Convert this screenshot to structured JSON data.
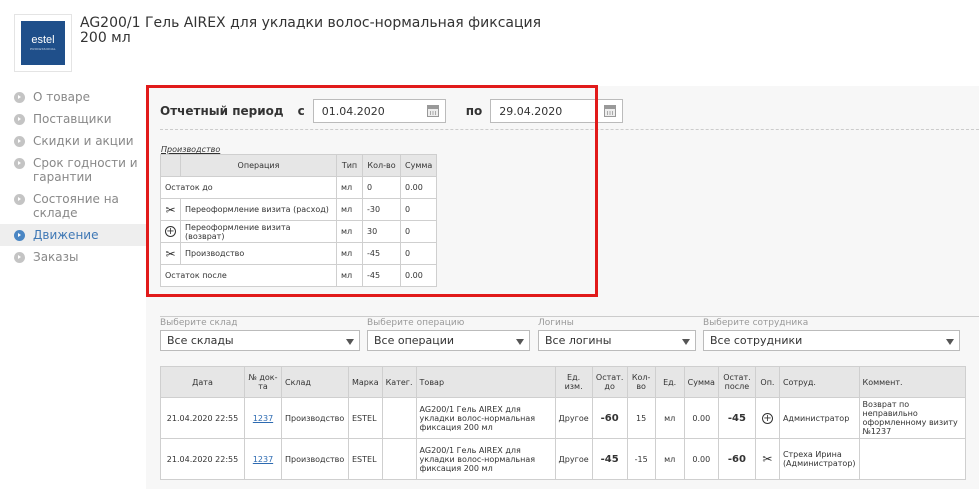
{
  "header": {
    "logo_text": "estel",
    "logo_subtext": "PROFESSIONAL",
    "title_line1": "AG200/1 Гель AIREX для укладки волос-нормальная фиксация",
    "title_line2": "200 мл"
  },
  "sidebar": {
    "items": [
      {
        "label": "О товаре",
        "active": false
      },
      {
        "label": "Поставщики",
        "active": false
      },
      {
        "label": "Скидки и акции",
        "active": false
      },
      {
        "label": "Срок годности и гарантии",
        "active": false
      },
      {
        "label": "Состояние на складе",
        "active": false
      },
      {
        "label": "Движение",
        "active": true
      },
      {
        "label": "Заказы",
        "active": false
      }
    ]
  },
  "period": {
    "label": "Отчетный период",
    "from_label": "с",
    "from_value": "01.04.2020",
    "to_label": "по",
    "to_value": "29.04.2020"
  },
  "production": {
    "title": "Производство",
    "headers": [
      "Операция",
      "Тип",
      "Кол-во",
      "Сумма"
    ],
    "rows": [
      {
        "icon": "",
        "op": "Остаток до",
        "type": "мл",
        "qty": "0",
        "sum": "0.00"
      },
      {
        "icon": "scissors-icon",
        "op": "Переоформление визита (расход)",
        "type": "мл",
        "qty": "-30",
        "sum": "0"
      },
      {
        "icon": "plus-circle-icon",
        "op": "Переоформление визита (возврат)",
        "type": "мл",
        "qty": "30",
        "sum": "0"
      },
      {
        "icon": "scissors-icon",
        "op": "Производство",
        "type": "мл",
        "qty": "-45",
        "sum": "0"
      },
      {
        "icon": "",
        "op": "Остаток после",
        "type": "мл",
        "qty": "-45",
        "sum": "0.00"
      }
    ]
  },
  "filters": {
    "warehouse": {
      "label": "Выберите склад",
      "value": "Все склады"
    },
    "operation": {
      "label": "Выберите операцию",
      "value": "Все операции"
    },
    "logins": {
      "label": "Логины",
      "value": "Все логины"
    },
    "employee": {
      "label": "Выберите сотрудника",
      "value": "Все сотрудники"
    }
  },
  "movements": {
    "headers": {
      "date": "Дата",
      "doc": "№ док-та",
      "warehouse": "Склад",
      "brand": "Марка",
      "category": "Катег.",
      "product": "Товар",
      "unit": "Ед. изм.",
      "rest_before": "Остат. до",
      "qty": "Кол-во",
      "unit2": "Ед.",
      "sum": "Сумма",
      "rest_after": "Остат. после",
      "op": "Оп.",
      "employee": "Сотруд.",
      "comment": "Коммент."
    },
    "rows": [
      {
        "date": "21.04.2020 22:55",
        "doc": "1237",
        "warehouse": "Производство",
        "brand": "ESTEL",
        "category": "",
        "product": "AG200/1 Гель AIREX для укладки волос-нормальная фиксация 200 мл",
        "unit": "Другое",
        "rest_before": "-60",
        "qty": "15",
        "unit2": "мл",
        "sum": "0.00",
        "rest_after": "-45",
        "op_icon": "plus-circle-icon",
        "employee": "Администратор",
        "comment": "Возврат по неправильно оформленному визиту №1237"
      },
      {
        "date": "21.04.2020 22:55",
        "doc": "1237",
        "warehouse": "Производство",
        "brand": "ESTEL",
        "category": "",
        "product": "AG200/1 Гель AIREX для укладки волос-нормальная фиксация 200 мл",
        "unit": "Другое",
        "rest_before": "-45",
        "qty": "-15",
        "unit2": "мл",
        "sum": "0.00",
        "rest_after": "-60",
        "op_icon": "scissors-icon",
        "employee": "Стреха Ирина (Администратор)",
        "comment": ""
      }
    ]
  },
  "colors": {
    "highlight_border": "#e11a1a",
    "active_nav": "#3f78b5",
    "link": "#2c6ab1",
    "logo_bg": "#1f4f8a"
  }
}
